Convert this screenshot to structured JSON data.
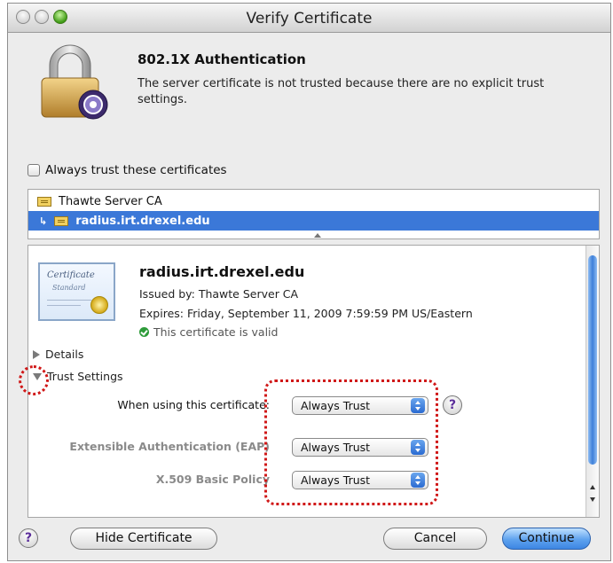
{
  "window": {
    "title": "Verify Certificate"
  },
  "header": {
    "heading": "802.1X Authentication",
    "message": "The server certificate is not trusted because there are no explicit trust settings."
  },
  "trust_checkbox": {
    "label": "Always trust these certificates",
    "checked": false
  },
  "cert_chain": [
    {
      "label": "Thawte Server CA",
      "selected": false
    },
    {
      "label": "radius.irt.drexel.edu",
      "selected": true
    }
  ],
  "certificate": {
    "image_title": "Certificate",
    "image_subtitle": "Standard",
    "name": "radius.irt.drexel.edu",
    "issued_by": "Issued by: Thawte Server CA",
    "expires": "Expires: Friday, September 11, 2009 7:59:59 PM US/Eastern",
    "status": "This certificate is valid"
  },
  "sections": {
    "details": "Details",
    "trust_settings": "Trust Settings"
  },
  "trust_rows": [
    {
      "label": "When using this certificate:",
      "value": "Always Trust"
    },
    {
      "label": "Extensible Authentication (EAP)",
      "value": "Always Trust"
    },
    {
      "label": "X.509 Basic Policy",
      "value": "Always Trust"
    }
  ],
  "buttons": {
    "help": "?",
    "hide_certificate": "Hide Certificate",
    "cancel": "Cancel",
    "continue": "Continue"
  },
  "colors": {
    "selection": "#3b78d8",
    "annotation": "#d01818",
    "default_button": "#3d86e3"
  }
}
